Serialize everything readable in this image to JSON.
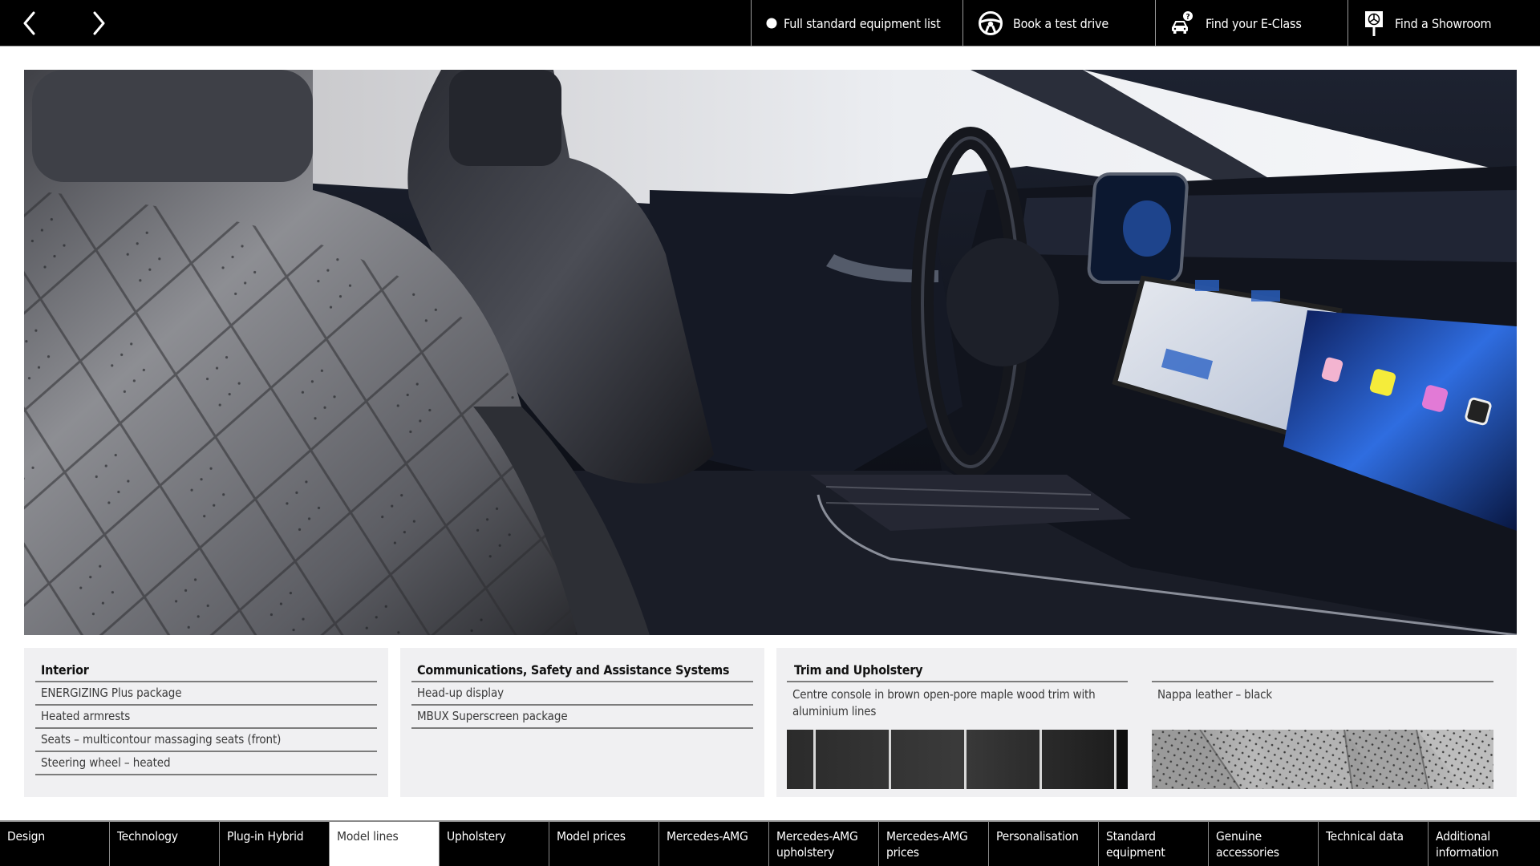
{
  "topbar": {
    "prev_label": "Previous",
    "next_label": "Next",
    "actions": [
      {
        "label": "Full standard equipment list",
        "icon": "dot-icon"
      },
      {
        "label": "Book a test drive",
        "icon": "steering-wheel-icon"
      },
      {
        "label": "Find your E-Class",
        "icon": "car-question-icon"
      },
      {
        "label": "Find a Showroom",
        "icon": "showroom-sign-icon"
      }
    ]
  },
  "hero": {
    "alt": "Mercedes-Benz E-Class interior with quilted perforated Nappa leather seats and MBUX Superscreen"
  },
  "panels": {
    "interior": {
      "title": "Interior",
      "items": [
        "ENERGIZING Plus package",
        "Heated armrests",
        "Seats – multicontour massaging seats (front)",
        "Steering wheel – heated"
      ]
    },
    "comms": {
      "title": "Communications, Safety and Assistance Systems",
      "items": [
        "Head-up display",
        "MBUX Superscreen package"
      ]
    },
    "trim": {
      "title": "Trim and Upholstery",
      "options": [
        {
          "label": "Centre console in brown open-pore maple wood trim with aluminium lines",
          "swatch": "wood-aluminium-swatch"
        },
        {
          "label": "Nappa leather – black",
          "swatch": "nappa-leather-swatch"
        }
      ]
    }
  },
  "bottomnav": {
    "active_index": 3,
    "tabs": [
      "Design",
      "Technology",
      "Plug-in Hybrid",
      "Model lines",
      "Upholstery",
      "Model prices",
      "Mercedes-AMG",
      "Mercedes-AMG upholstery",
      "Mercedes-AMG prices",
      "Personalisation",
      "Standard equipment",
      "Genuine accessories",
      "Technical data",
      "Additional information"
    ]
  },
  "colors": {
    "bar_bg": "#000000",
    "panel_bg": "#f0f0f2",
    "active_tab_bg": "#ffffff",
    "divider": "#7c7c7c"
  }
}
